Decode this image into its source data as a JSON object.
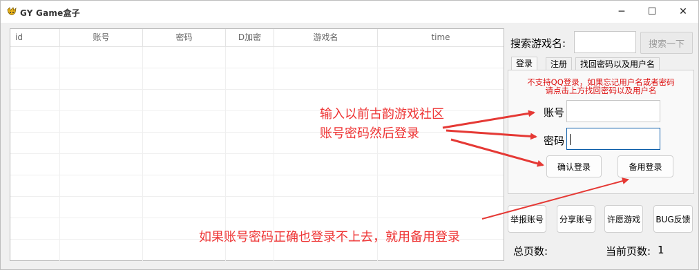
{
  "window": {
    "title": "GY Game盒子",
    "minimize_glyph": "─",
    "maximize_glyph": "☐",
    "close_glyph": "✕"
  },
  "table": {
    "columns": [
      "id",
      "账号",
      "密码",
      "D加密",
      "游戏名",
      "time"
    ],
    "rows": []
  },
  "search": {
    "label": "搜索游戏名:",
    "value": "",
    "button_label": "搜索一下"
  },
  "tabs": [
    {
      "label": "登录",
      "active": true
    },
    {
      "label": "注册",
      "active": false
    },
    {
      "label": "找回密码以及用户名",
      "active": false
    }
  ],
  "login": {
    "notice_line1": "不支持QQ登录，如果忘记用户名或者密码",
    "notice_line2": "请点击上方找回密码以及用户名",
    "account_label": "账号",
    "account_value": "",
    "password_label": "密码",
    "password_value": "",
    "confirm_button": "确认登录",
    "backup_button": "备用登录"
  },
  "actions": [
    "举报账号",
    "分享账号",
    "许愿游戏",
    "BUG反馈"
  ],
  "footer": {
    "total_pages_label": "总页数:",
    "current_page_label": "当前页数:",
    "current_page_value": "1"
  },
  "annotations": {
    "line1": "输入以前古韵游戏社区",
    "line2": "账号密码然后登录",
    "line3": "如果账号密码正确也登录不上去，就用备用登录",
    "color": "#e53935"
  },
  "icons": {
    "app_icon": "app-logo-icon"
  }
}
